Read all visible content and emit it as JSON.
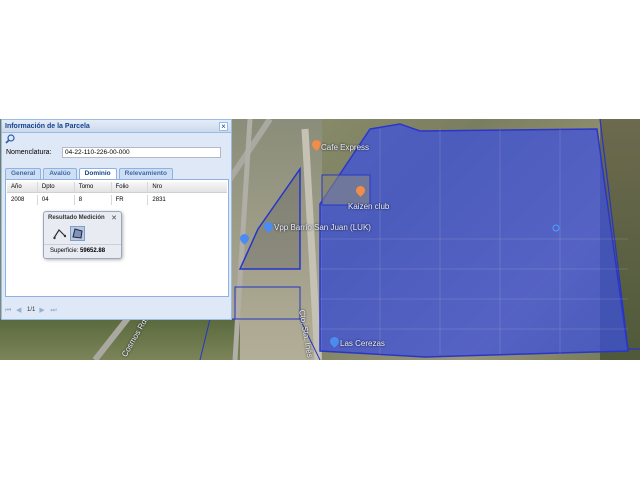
{
  "panel": {
    "title": "Información de la Parcela",
    "close_glyph": "×",
    "toolbar_icon": "zoom-icon",
    "nomenclatura_label": "Nomenclatura:",
    "nomenclatura_value": "04-22-110-226-00-000",
    "tabs": [
      {
        "label": "General",
        "active": false
      },
      {
        "label": "Avalúo",
        "active": false
      },
      {
        "label": "Dominio",
        "active": true
      },
      {
        "label": "Relevamiento",
        "active": false
      }
    ],
    "grid": {
      "columns": [
        "Año",
        "Dpto",
        "Tomo",
        "Folio",
        "Nro"
      ],
      "rows": [
        [
          "2008",
          "04",
          "8",
          "FR",
          "2831"
        ]
      ]
    },
    "pager": {
      "page": "1/1"
    }
  },
  "medicion": {
    "title": "Resultado Medición",
    "close_glyph": "✕",
    "superficie_label": "Superficie:",
    "superficie_value": "59652.88"
  },
  "map": {
    "labels": [
      "Cafe Express",
      "Kaizen club",
      "Vpp Barrio San Juan (LUK)",
      "Las Cerezas",
      "Cto. Sta. Inés",
      "Cosmos Rd."
    ],
    "parcel_fill": "#3a4fe0",
    "parcel_stroke": "#2b36c8"
  }
}
